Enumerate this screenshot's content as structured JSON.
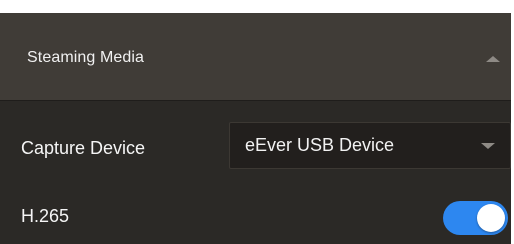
{
  "section": {
    "title": "Steaming Media",
    "expanded": true,
    "collapse_icon": "chevron-up-icon"
  },
  "capture_device": {
    "label": "Capture Device",
    "selected": "eEver USB Device",
    "dropdown_icon": "chevron-down-icon"
  },
  "h265": {
    "label": "H.265",
    "enabled": true
  },
  "colors": {
    "panel_background": "#2b2926",
    "header_background": "#403c37",
    "select_background": "#221f1d",
    "toggle_on": "#2d87f0",
    "text": "#f5f5f5"
  }
}
